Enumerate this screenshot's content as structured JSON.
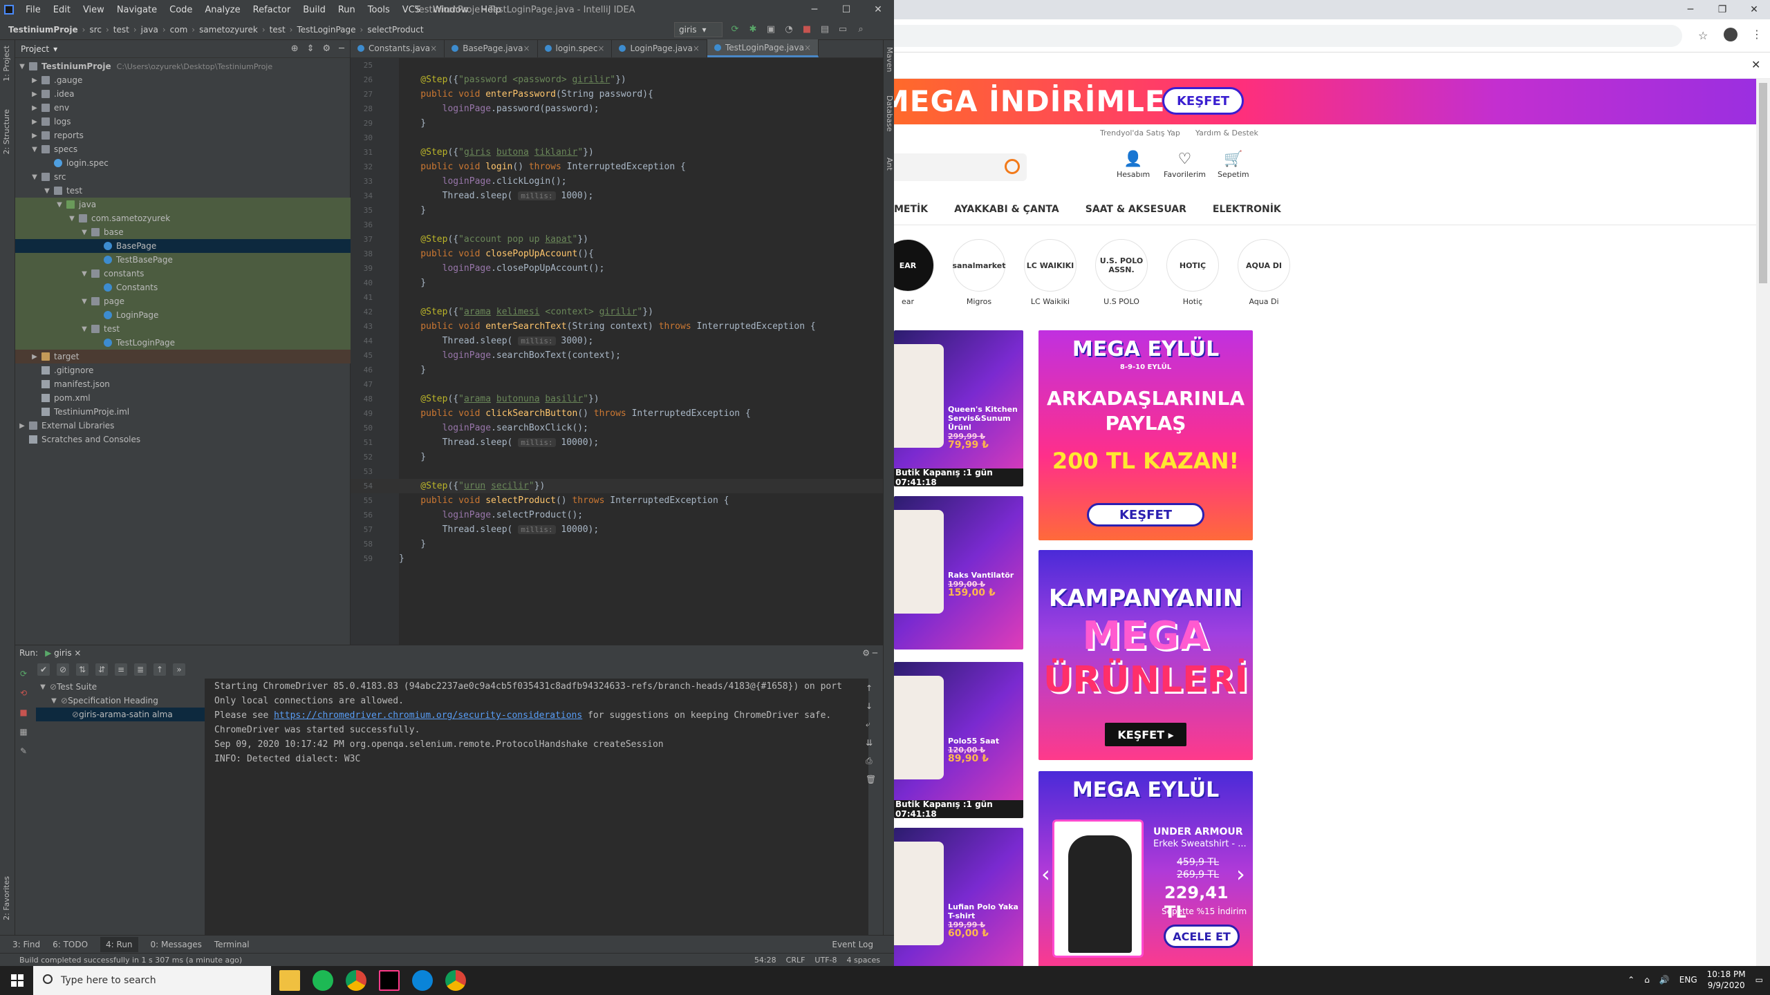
{
  "ide": {
    "menu": [
      "File",
      "Edit",
      "View",
      "Navigate",
      "Code",
      "Analyze",
      "Refactor",
      "Build",
      "Run",
      "Tools",
      "VCS",
      "Window",
      "Help"
    ],
    "window_title": "TestiniumProje - TestLoginPage.java - IntelliJ IDEA",
    "breadcrumbs": [
      "TestiniumProje",
      "src",
      "test",
      "java",
      "com",
      "sametozyurek",
      "test",
      "TestLoginPage",
      "selectProduct"
    ],
    "run_config": "giris",
    "left_tabs": {
      "project": "1: Project",
      "structure": "2: Structure",
      "favorites": "2: Favorites"
    },
    "right_tabs": {
      "maven": "Maven",
      "database": "Database",
      "ant": "Ant"
    },
    "project_header": "Project",
    "tree": [
      {
        "label": "TestiniumProje",
        "path": "C:\\Users\\ozyurek\\Desktop\\TestiniumProje",
        "depth": 0,
        "arrow": "▼",
        "icon": "folder",
        "bold": true
      },
      {
        "label": ".gauge",
        "depth": 1,
        "arrow": "▶",
        "icon": "folder"
      },
      {
        "label": ".idea",
        "depth": 1,
        "arrow": "▶",
        "icon": "folder"
      },
      {
        "label": "env",
        "depth": 1,
        "arrow": "▶",
        "icon": "folder"
      },
      {
        "label": "logs",
        "depth": 1,
        "arrow": "▶",
        "icon": "folder"
      },
      {
        "label": "reports",
        "depth": 1,
        "arrow": "▶",
        "icon": "folder"
      },
      {
        "label": "specs",
        "depth": 1,
        "arrow": "▼",
        "icon": "folder"
      },
      {
        "label": "login.spec",
        "depth": 2,
        "arrow": "",
        "icon": "spec"
      },
      {
        "label": "src",
        "depth": 1,
        "arrow": "▼",
        "icon": "folder"
      },
      {
        "label": "test",
        "depth": 2,
        "arrow": "▼",
        "icon": "folder"
      },
      {
        "label": "java",
        "depth": 3,
        "arrow": "▼",
        "icon": "grn",
        "hl": true
      },
      {
        "label": "com.sametozyurek",
        "depth": 4,
        "arrow": "▼",
        "icon": "folder",
        "hl": true
      },
      {
        "label": "base",
        "depth": 5,
        "arrow": "▼",
        "icon": "folder",
        "hl": true
      },
      {
        "label": "BasePage",
        "depth": 6,
        "arrow": "",
        "icon": "cls",
        "sel": true
      },
      {
        "label": "TestBasePage",
        "depth": 6,
        "arrow": "",
        "icon": "cls",
        "hl": true
      },
      {
        "label": "constants",
        "depth": 5,
        "arrow": "▼",
        "icon": "folder",
        "hl": true
      },
      {
        "label": "Constants",
        "depth": 6,
        "arrow": "",
        "icon": "cls",
        "hl": true
      },
      {
        "label": "page",
        "depth": 5,
        "arrow": "▼",
        "icon": "folder",
        "hl": true
      },
      {
        "label": "LoginPage",
        "depth": 6,
        "arrow": "",
        "icon": "cls",
        "hl": true
      },
      {
        "label": "test",
        "depth": 5,
        "arrow": "▼",
        "icon": "folder",
        "hl": true
      },
      {
        "label": "TestLoginPage",
        "depth": 6,
        "arrow": "",
        "icon": "cls",
        "hl": true
      },
      {
        "label": "target",
        "depth": 1,
        "arrow": "▶",
        "icon": "y",
        "tgt": true
      },
      {
        "label": ".gitignore",
        "depth": 1,
        "arrow": "",
        "icon": "file"
      },
      {
        "label": "manifest.json",
        "depth": 1,
        "arrow": "",
        "icon": "file"
      },
      {
        "label": "pom.xml",
        "depth": 1,
        "arrow": "",
        "icon": "file"
      },
      {
        "label": "TestiniumProje.iml",
        "depth": 1,
        "arrow": "",
        "icon": "file"
      },
      {
        "label": "External Libraries",
        "depth": 0,
        "arrow": "▶",
        "icon": "folder"
      },
      {
        "label": "Scratches and Consoles",
        "depth": 0,
        "arrow": "",
        "icon": "file"
      }
    ],
    "editor_tabs": [
      {
        "label": "Constants.java",
        "active": false
      },
      {
        "label": "BasePage.java",
        "active": false
      },
      {
        "label": "login.spec",
        "active": false
      },
      {
        "label": "LoginPage.java",
        "active": false
      },
      {
        "label": "TestLoginPage.java",
        "active": true
      }
    ],
    "code_lines": [
      {
        "n": "25",
        "seg": []
      },
      {
        "n": "26",
        "seg": [
          [
            "ann",
            "    @Step"
          ],
          [
            "pl",
            "({"
          ],
          [
            "str",
            "\"password <password> "
          ],
          [
            "strU",
            "girilir"
          ],
          [
            "str",
            "\""
          ],
          [
            "pl",
            "})"
          ]
        ]
      },
      {
        "n": "27",
        "seg": [
          [
            "kw",
            "    public void "
          ],
          [
            "fn",
            "enterPassword"
          ],
          [
            "pl",
            "(String password){"
          ]
        ]
      },
      {
        "n": "28",
        "seg": [
          [
            "fld",
            "        loginPage"
          ],
          [
            "pl",
            ".password(password);"
          ]
        ]
      },
      {
        "n": "29",
        "seg": [
          [
            "pl",
            "    }"
          ]
        ]
      },
      {
        "n": "30",
        "seg": []
      },
      {
        "n": "31",
        "seg": [
          [
            "ann",
            "    @Step"
          ],
          [
            "pl",
            "({"
          ],
          [
            "str",
            "\""
          ],
          [
            "strU",
            "giris"
          ],
          [
            "str",
            " "
          ],
          [
            "strU",
            "butona"
          ],
          [
            "str",
            " "
          ],
          [
            "strU",
            "tiklanir"
          ],
          [
            "str",
            "\""
          ],
          [
            "pl",
            "})"
          ]
        ]
      },
      {
        "n": "32",
        "seg": [
          [
            "kw",
            "    public void "
          ],
          [
            "fn",
            "login"
          ],
          [
            "pl",
            "() "
          ],
          [
            "kw",
            "throws "
          ],
          [
            "pl",
            "InterruptedException {"
          ]
        ]
      },
      {
        "n": "33",
        "seg": [
          [
            "fld",
            "        loginPage"
          ],
          [
            "pl",
            ".clickLogin();"
          ]
        ]
      },
      {
        "n": "34",
        "seg": [
          [
            "pl",
            "        Thread."
          ],
          [
            "pl",
            "sleep( "
          ],
          [
            "hint",
            "millis:"
          ],
          [
            "pl",
            " 1000);"
          ]
        ]
      },
      {
        "n": "35",
        "seg": [
          [
            "pl",
            "    }"
          ]
        ]
      },
      {
        "n": "36",
        "seg": []
      },
      {
        "n": "37",
        "seg": [
          [
            "ann",
            "    @Step"
          ],
          [
            "pl",
            "({"
          ],
          [
            "str",
            "\"account pop up "
          ],
          [
            "strU",
            "kapat"
          ],
          [
            "str",
            "\""
          ],
          [
            "pl",
            "})"
          ]
        ]
      },
      {
        "n": "38",
        "seg": [
          [
            "kw",
            "    public void "
          ],
          [
            "fn",
            "closePopUpAccount"
          ],
          [
            "pl",
            "(){"
          ]
        ]
      },
      {
        "n": "39",
        "seg": [
          [
            "fld",
            "        loginPage"
          ],
          [
            "pl",
            ".closePopUpAccount();"
          ]
        ]
      },
      {
        "n": "40",
        "seg": [
          [
            "pl",
            "    }"
          ]
        ]
      },
      {
        "n": "41",
        "seg": []
      },
      {
        "n": "42",
        "seg": [
          [
            "ann",
            "    @Step"
          ],
          [
            "pl",
            "({"
          ],
          [
            "str",
            "\""
          ],
          [
            "strU",
            "arama"
          ],
          [
            "str",
            " "
          ],
          [
            "strU",
            "kelimesi"
          ],
          [
            "str",
            " <context> "
          ],
          [
            "strU",
            "girilir"
          ],
          [
            "str",
            "\""
          ],
          [
            "pl",
            "})"
          ]
        ]
      },
      {
        "n": "43",
        "seg": [
          [
            "kw",
            "    public void "
          ],
          [
            "fn",
            "enterSearchText"
          ],
          [
            "pl",
            "(String context) "
          ],
          [
            "kw",
            "throws "
          ],
          [
            "pl",
            "InterruptedException {"
          ]
        ]
      },
      {
        "n": "44",
        "seg": [
          [
            "pl",
            "        Thread."
          ],
          [
            "pl",
            "sleep( "
          ],
          [
            "hint",
            "millis:"
          ],
          [
            "pl",
            " 3000);"
          ]
        ]
      },
      {
        "n": "45",
        "seg": [
          [
            "fld",
            "        loginPage"
          ],
          [
            "pl",
            ".searchBoxText(context);"
          ]
        ]
      },
      {
        "n": "46",
        "seg": [
          [
            "pl",
            "    }"
          ]
        ]
      },
      {
        "n": "47",
        "seg": []
      },
      {
        "n": "48",
        "seg": [
          [
            "ann",
            "    @Step"
          ],
          [
            "pl",
            "({"
          ],
          [
            "str",
            "\""
          ],
          [
            "strU",
            "arama"
          ],
          [
            "str",
            " "
          ],
          [
            "strU",
            "butonuna"
          ],
          [
            "str",
            " "
          ],
          [
            "strU",
            "basilir"
          ],
          [
            "str",
            "\""
          ],
          [
            "pl",
            "})"
          ]
        ]
      },
      {
        "n": "49",
        "seg": [
          [
            "kw",
            "    public void "
          ],
          [
            "fn",
            "clickSearchButton"
          ],
          [
            "pl",
            "() "
          ],
          [
            "kw",
            "throws "
          ],
          [
            "pl",
            "InterruptedException {"
          ]
        ]
      },
      {
        "n": "50",
        "seg": [
          [
            "fld",
            "        loginPage"
          ],
          [
            "pl",
            ".searchBoxClick();"
          ]
        ]
      },
      {
        "n": "51",
        "seg": [
          [
            "pl",
            "        Thread."
          ],
          [
            "pl",
            "sleep( "
          ],
          [
            "hint",
            "millis:"
          ],
          [
            "pl",
            " 10000);"
          ]
        ]
      },
      {
        "n": "52",
        "seg": [
          [
            "pl",
            "    }"
          ]
        ]
      },
      {
        "n": "53",
        "seg": []
      },
      {
        "n": "54",
        "cur": true,
        "seg": [
          [
            "ann",
            "    @Step"
          ],
          [
            "pl",
            "({"
          ],
          [
            "str",
            "\""
          ],
          [
            "strU",
            "urun"
          ],
          [
            "str",
            " "
          ],
          [
            "strU",
            "secilir"
          ],
          [
            "str",
            "\""
          ],
          [
            "pl",
            "})"
          ]
        ]
      },
      {
        "n": "55",
        "seg": [
          [
            "kw",
            "    public void "
          ],
          [
            "fn",
            "selectProduct"
          ],
          [
            "pl",
            "() "
          ],
          [
            "kw",
            "throws "
          ],
          [
            "pl",
            "InterruptedException {"
          ]
        ]
      },
      {
        "n": "56",
        "seg": [
          [
            "fld",
            "        loginPage"
          ],
          [
            "pl",
            ".selectProduct();"
          ]
        ]
      },
      {
        "n": "57",
        "seg": [
          [
            "pl",
            "        Thread."
          ],
          [
            "pl",
            "sleep( "
          ],
          [
            "hint",
            "millis:"
          ],
          [
            "pl",
            " 10000);"
          ]
        ]
      },
      {
        "n": "58",
        "seg": [
          [
            "pl",
            "    }"
          ]
        ]
      },
      {
        "n": "59",
        "seg": [
          [
            "pl",
            "}"
          ]
        ]
      }
    ],
    "run": {
      "label": "Run:",
      "tab": "giris",
      "tests": [
        {
          "label": "Test Suite",
          "depth": 0,
          "arrow": "▼"
        },
        {
          "label": "Specification Heading",
          "depth": 1,
          "arrow": "▼"
        },
        {
          "label": "giris-arama-satin alma",
          "depth": 2,
          "arrow": "",
          "sel": true
        }
      ],
      "console": [
        "Starting ChromeDriver 85.0.4183.83 (94abc2237ae0c9a4cb5f035431c8adfb94324633-refs/branch-heads/4183@{#1658}) on port",
        "Only local connections are allowed.",
        "Please see https://chromedriver.chromium.org/security-considerations for suggestions on keeping ChromeDriver safe.",
        "ChromeDriver was started successfully.",
        "Sep 09, 2020 10:17:42 PM org.openqa.selenium.remote.ProtocolHandshake createSession",
        "INFO: Detected dialect: W3C"
      ],
      "console_link": "https://chromedriver.chromium.org/security-considerations",
      "console_link_pre": "Please see ",
      "console_link_post": " for suggestions on keeping ChromeDriver safe."
    },
    "bottom_tabs": [
      "3: Find",
      "6: TODO",
      "4: Run",
      "0: Messages",
      "Terminal"
    ],
    "event_log": "Event Log",
    "status": "Build completed successfully in 1 s 307 ms (a minute ago)",
    "status_right": [
      "54:28",
      "CRLF",
      "UTF-8",
      "4 spaces"
    ]
  },
  "browser": {
    "banner_text": "MEGA İNDİRİMLER",
    "banner_button": "KEŞFET",
    "top_links": [
      "Trendyol'da Satış Yap",
      "Yardım & Destek"
    ],
    "user_actions": [
      "Hesabım",
      "Favorilerim",
      "Sepetim"
    ],
    "categories": [
      "METİK",
      "AYAKKABI & ÇANTA",
      "SAAT & AKSESUAR",
      "ELEKTRONİK"
    ],
    "stores": [
      {
        "logo": "EAR",
        "label": "ear"
      },
      {
        "logo": "sanalmarket",
        "label": "Migros"
      },
      {
        "logo": "LC WAIKIKI",
        "label": "LC Waikiki"
      },
      {
        "logo": "U.S. POLO ASSN.",
        "label": "U.S POLO"
      },
      {
        "logo": "HOTIÇ",
        "label": "Hotiç"
      },
      {
        "logo": "AQUA DI",
        "label": "Aqua Di"
      }
    ],
    "cards": [
      {
        "name": "Queen's Kitchen Servis&Sunum Ürünl",
        "old": "299,99 ₺",
        "new": "79,99 ₺",
        "bar": "Butik Kapanış :1 gün 07:41:18"
      },
      {
        "name": "Raks Vantilatör",
        "old": "199,00 ₺",
        "new": "159,00 ₺",
        "bar": ""
      },
      {
        "name": "Polo55 Saat",
        "old": "120,00 ₺",
        "new": "89,90 ₺",
        "bar": "Butik Kapanış :1 gün 07:41:18"
      },
      {
        "name": "Lufian Polo Yaka T-shirt",
        "old": "199,99 ₺",
        "new": "60,00 ₺",
        "bar": ""
      }
    ],
    "promo1": {
      "logo": "MEGA EYLÜL",
      "date": "8-9-10 EYLÜL",
      "line1": "ARKADAŞLARINLA",
      "line2": "PAYLAŞ",
      "line3": "200 TL KAZAN!",
      "button": "KEŞFET"
    },
    "promo2": {
      "line1": "KAMPANYANIN",
      "line2": "MEGA",
      "line3": "ÜRÜNLERİ",
      "button": "KEŞFET ▸"
    },
    "promo3": {
      "logo": "MEGA EYLÜL",
      "brand": "UNDER ARMOUR",
      "product": "Erkek Sweatshirt - ...",
      "old1": "459,9 TL",
      "old2": "269,9 TL",
      "price": "229,41 TL",
      "discount": "Sepette %15 İndirim",
      "button": "ACELE ET"
    }
  },
  "taskbar": {
    "search_placeholder": "Type here to search",
    "lang": "ENG",
    "time": "10:18 PM",
    "date": "9/9/2020"
  },
  "colors": {
    "ide_bg": "#3c3f41",
    "editor_bg": "#2b2b2b",
    "keyword": "#cc7832",
    "annotation": "#bbb529",
    "string": "#6a8759",
    "function": "#ffc66d",
    "field": "#9876aa",
    "brand_orange": "#f27a1a"
  }
}
